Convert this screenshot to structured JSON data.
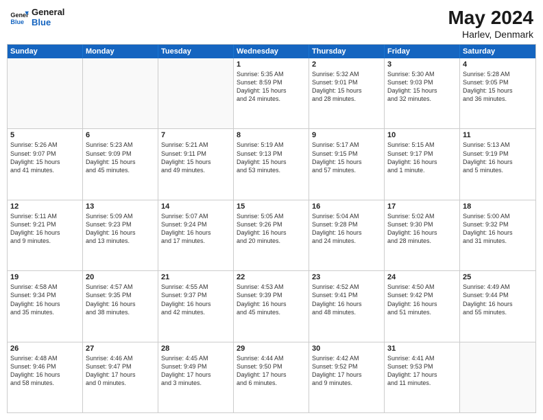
{
  "logo": {
    "general": "General",
    "blue": "Blue"
  },
  "title": {
    "month_year": "May 2024",
    "location": "Harlev, Denmark"
  },
  "header_days": [
    "Sunday",
    "Monday",
    "Tuesday",
    "Wednesday",
    "Thursday",
    "Friday",
    "Saturday"
  ],
  "rows": [
    [
      {
        "day": "",
        "text": "",
        "empty": true
      },
      {
        "day": "",
        "text": "",
        "empty": true
      },
      {
        "day": "",
        "text": "",
        "empty": true
      },
      {
        "day": "1",
        "text": "Sunrise: 5:35 AM\nSunset: 8:59 PM\nDaylight: 15 hours\nand 24 minutes."
      },
      {
        "day": "2",
        "text": "Sunrise: 5:32 AM\nSunset: 9:01 PM\nDaylight: 15 hours\nand 28 minutes."
      },
      {
        "day": "3",
        "text": "Sunrise: 5:30 AM\nSunset: 9:03 PM\nDaylight: 15 hours\nand 32 minutes."
      },
      {
        "day": "4",
        "text": "Sunrise: 5:28 AM\nSunset: 9:05 PM\nDaylight: 15 hours\nand 36 minutes."
      }
    ],
    [
      {
        "day": "5",
        "text": "Sunrise: 5:26 AM\nSunset: 9:07 PM\nDaylight: 15 hours\nand 41 minutes."
      },
      {
        "day": "6",
        "text": "Sunrise: 5:23 AM\nSunset: 9:09 PM\nDaylight: 15 hours\nand 45 minutes."
      },
      {
        "day": "7",
        "text": "Sunrise: 5:21 AM\nSunset: 9:11 PM\nDaylight: 15 hours\nand 49 minutes."
      },
      {
        "day": "8",
        "text": "Sunrise: 5:19 AM\nSunset: 9:13 PM\nDaylight: 15 hours\nand 53 minutes."
      },
      {
        "day": "9",
        "text": "Sunrise: 5:17 AM\nSunset: 9:15 PM\nDaylight: 15 hours\nand 57 minutes."
      },
      {
        "day": "10",
        "text": "Sunrise: 5:15 AM\nSunset: 9:17 PM\nDaylight: 16 hours\nand 1 minute."
      },
      {
        "day": "11",
        "text": "Sunrise: 5:13 AM\nSunset: 9:19 PM\nDaylight: 16 hours\nand 5 minutes."
      }
    ],
    [
      {
        "day": "12",
        "text": "Sunrise: 5:11 AM\nSunset: 9:21 PM\nDaylight: 16 hours\nand 9 minutes."
      },
      {
        "day": "13",
        "text": "Sunrise: 5:09 AM\nSunset: 9:23 PM\nDaylight: 16 hours\nand 13 minutes."
      },
      {
        "day": "14",
        "text": "Sunrise: 5:07 AM\nSunset: 9:24 PM\nDaylight: 16 hours\nand 17 minutes."
      },
      {
        "day": "15",
        "text": "Sunrise: 5:05 AM\nSunset: 9:26 PM\nDaylight: 16 hours\nand 20 minutes."
      },
      {
        "day": "16",
        "text": "Sunrise: 5:04 AM\nSunset: 9:28 PM\nDaylight: 16 hours\nand 24 minutes."
      },
      {
        "day": "17",
        "text": "Sunrise: 5:02 AM\nSunset: 9:30 PM\nDaylight: 16 hours\nand 28 minutes."
      },
      {
        "day": "18",
        "text": "Sunrise: 5:00 AM\nSunset: 9:32 PM\nDaylight: 16 hours\nand 31 minutes."
      }
    ],
    [
      {
        "day": "19",
        "text": "Sunrise: 4:58 AM\nSunset: 9:34 PM\nDaylight: 16 hours\nand 35 minutes."
      },
      {
        "day": "20",
        "text": "Sunrise: 4:57 AM\nSunset: 9:35 PM\nDaylight: 16 hours\nand 38 minutes."
      },
      {
        "day": "21",
        "text": "Sunrise: 4:55 AM\nSunset: 9:37 PM\nDaylight: 16 hours\nand 42 minutes."
      },
      {
        "day": "22",
        "text": "Sunrise: 4:53 AM\nSunset: 9:39 PM\nDaylight: 16 hours\nand 45 minutes."
      },
      {
        "day": "23",
        "text": "Sunrise: 4:52 AM\nSunset: 9:41 PM\nDaylight: 16 hours\nand 48 minutes."
      },
      {
        "day": "24",
        "text": "Sunrise: 4:50 AM\nSunset: 9:42 PM\nDaylight: 16 hours\nand 51 minutes."
      },
      {
        "day": "25",
        "text": "Sunrise: 4:49 AM\nSunset: 9:44 PM\nDaylight: 16 hours\nand 55 minutes."
      }
    ],
    [
      {
        "day": "26",
        "text": "Sunrise: 4:48 AM\nSunset: 9:46 PM\nDaylight: 16 hours\nand 58 minutes."
      },
      {
        "day": "27",
        "text": "Sunrise: 4:46 AM\nSunset: 9:47 PM\nDaylight: 17 hours\nand 0 minutes."
      },
      {
        "day": "28",
        "text": "Sunrise: 4:45 AM\nSunset: 9:49 PM\nDaylight: 17 hours\nand 3 minutes."
      },
      {
        "day": "29",
        "text": "Sunrise: 4:44 AM\nSunset: 9:50 PM\nDaylight: 17 hours\nand 6 minutes."
      },
      {
        "day": "30",
        "text": "Sunrise: 4:42 AM\nSunset: 9:52 PM\nDaylight: 17 hours\nand 9 minutes."
      },
      {
        "day": "31",
        "text": "Sunrise: 4:41 AM\nSunset: 9:53 PM\nDaylight: 17 hours\nand 11 minutes."
      },
      {
        "day": "",
        "text": "",
        "empty": true
      }
    ]
  ]
}
